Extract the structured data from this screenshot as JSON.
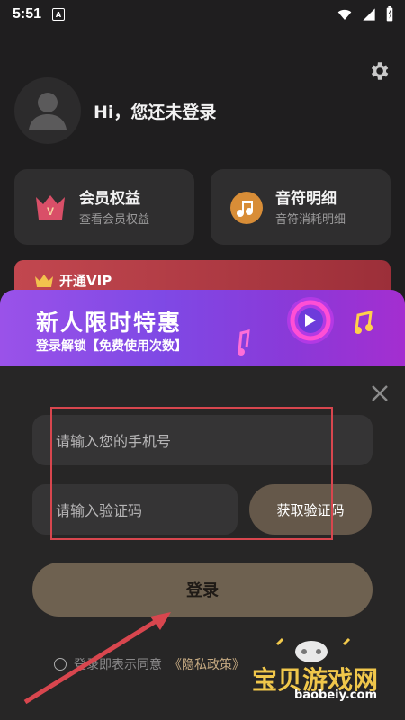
{
  "status": {
    "time": "5:51",
    "a_icon_label": "A",
    "icons": [
      "wifi-icon",
      "signal-icon",
      "battery-icon"
    ]
  },
  "header": {
    "greeting": "Hi，您还未登录"
  },
  "cards": [
    {
      "title": "会员权益",
      "subtitle": "查看会员权益",
      "icon": "vip-crown-icon"
    },
    {
      "title": "音符明细",
      "subtitle": "音符消耗明细",
      "icon": "music-note-icon"
    }
  ],
  "vip": {
    "label": "开通VIP"
  },
  "promo": {
    "title": "新人限时特惠",
    "subtitle": "登录解锁【免费使用次数】"
  },
  "login": {
    "phone_placeholder": "请输入您的手机号",
    "code_placeholder": "请输入验证码",
    "get_code": "获取验证码",
    "login_button": "登录",
    "agreement_text": "登录即表示同意",
    "privacy_policy": "《隐私政策》"
  },
  "watermark": {
    "name": "宝贝游戏网",
    "url": "baobeiy.com"
  },
  "colors": {
    "background": "#1f1e1f",
    "card": "#2f2e2f",
    "accent": "#6e6150",
    "promo": "#8a39d8",
    "highlight": "#d8464e"
  }
}
